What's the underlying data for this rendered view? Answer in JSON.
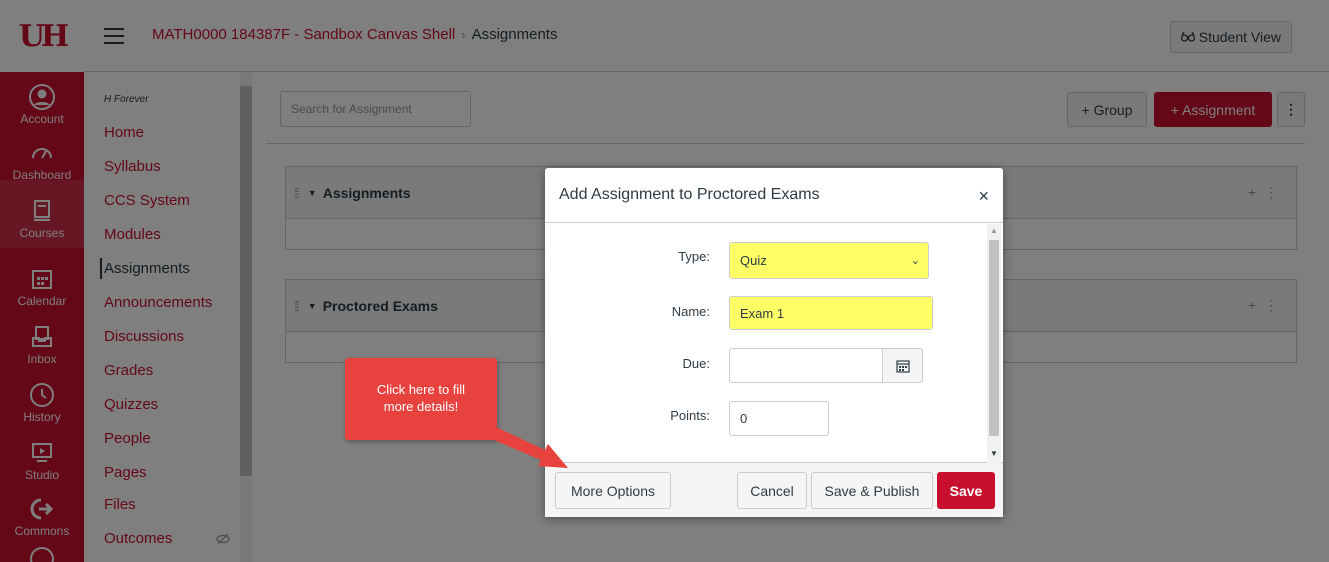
{
  "global_nav": {
    "logo_text": "UH",
    "items": [
      {
        "label": "Account",
        "icon": "account-icon"
      },
      {
        "label": "Dashboard",
        "icon": "dashboard-icon"
      },
      {
        "label": "Courses",
        "icon": "courses-icon"
      },
      {
        "label": "Calendar",
        "icon": "calendar-icon"
      },
      {
        "label": "Inbox",
        "icon": "inbox-icon"
      },
      {
        "label": "History",
        "icon": "history-icon"
      },
      {
        "label": "Studio",
        "icon": "studio-icon"
      },
      {
        "label": "Commons",
        "icon": "commons-icon"
      }
    ]
  },
  "header": {
    "course": "MATH0000 184387F - Sandbox Canvas Shell",
    "separator": "›",
    "current": "Assignments",
    "student_view": "Student View"
  },
  "course_nav": {
    "subtitle": "H Forever",
    "items": [
      "Home",
      "Syllabus",
      "CCS System",
      "Modules",
      "Assignments",
      "Announcements",
      "Discussions",
      "Grades",
      "Quizzes",
      "People",
      "Pages",
      "Files",
      "Outcomes"
    ],
    "active": "Assignments"
  },
  "toolbar": {
    "search_placeholder": "Search for Assignment",
    "group_btn": "+ Group",
    "assignment_btn": "+ Assignment"
  },
  "groups": [
    {
      "title": "Assignments"
    },
    {
      "title": "Proctored Exams"
    }
  ],
  "dialog": {
    "title": "Add Assignment to Proctored Exams",
    "close": "×",
    "type_label": "Type:",
    "type_value": "Quiz",
    "name_label": "Name:",
    "name_value": "Exam 1",
    "due_label": "Due:",
    "due_value": "",
    "points_label": "Points:",
    "points_value": "0",
    "more_options": "More Options",
    "cancel": "Cancel",
    "save_publish": "Save & Publish",
    "save": "Save"
  },
  "callout": {
    "text": "Click here to fill more details!"
  },
  "colors": {
    "brand": "#c8102e",
    "highlight": "#ffff66",
    "callout": "#e8423f"
  }
}
